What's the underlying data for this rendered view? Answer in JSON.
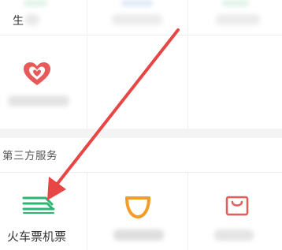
{
  "top_row": {
    "items": [
      {
        "label": "生",
        "icon": "blurred-icon"
      },
      {
        "label": "",
        "icon": "blurred-icon"
      },
      {
        "label": "",
        "icon": "blurred-icon"
      }
    ]
  },
  "middle_row": {
    "items": [
      {
        "label": "",
        "icon": "heart-icon",
        "icon_color": "#e65a5a"
      }
    ]
  },
  "third_party_section": {
    "title": "第三方服务",
    "items": [
      {
        "label": "火车票机票",
        "icon": "train-ticket-icon",
        "icon_color": "#2bb673"
      },
      {
        "label": "",
        "icon": "didi-icon",
        "icon_color": "#f39c2a"
      },
      {
        "label": "",
        "icon": "shopping-bag-icon",
        "icon_color": "#e65a5a"
      }
    ]
  },
  "colors": {
    "annotation_arrow": "#e84545"
  }
}
